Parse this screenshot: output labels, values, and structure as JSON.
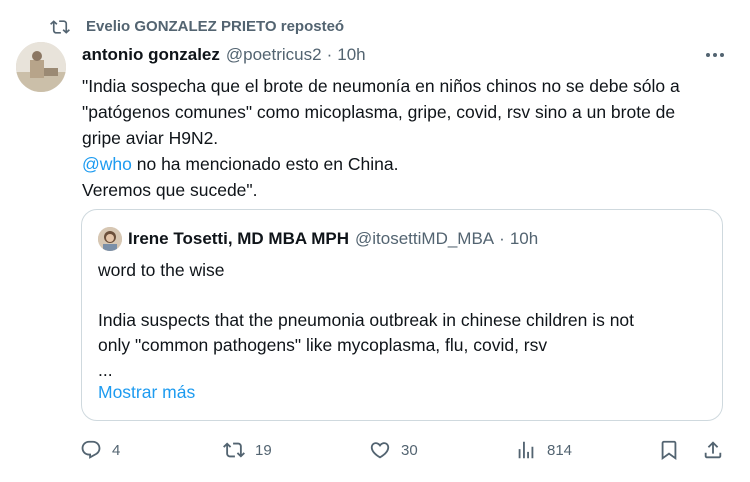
{
  "repost": {
    "icon": "repost-icon",
    "text": "Evelio GONZALEZ PRIETO reposteó"
  },
  "tweet": {
    "author_name": "antonio gonzalez",
    "handle": "@poetricus2",
    "separator": "·",
    "time": "10h",
    "body": {
      "line1": "\"India sospecha que el brote de neumonía en niños chinos no se debe sólo a",
      "line2": "\"patógenos comunes\" como micoplasma, gripe, covid, rsv sino a un brote de",
      "line3": "gripe aviar H9N2.",
      "mention": "@who",
      "line4_rest": " no ha mencionado esto en China.",
      "line5": "Veremos que sucede\"."
    }
  },
  "quote": {
    "author_name": "Irene Tosetti, MD MBA MPH",
    "handle": "@itosettiMD_MBA",
    "separator": "·",
    "time": "10h",
    "body": {
      "line1": "word to the wise",
      "line2": "",
      "line3": "India suspects that the pneumonia outbreak in chinese children is not",
      "line4": "only \"common pathogens\" like mycoplasma, flu, covid, rsv",
      "line5": "..."
    },
    "show_more": "Mostrar más"
  },
  "actions": {
    "reply": {
      "icon": "reply-icon",
      "count": "4"
    },
    "repost": {
      "icon": "repost-icon",
      "count": "19"
    },
    "like": {
      "icon": "heart-icon",
      "count": "30"
    },
    "views": {
      "icon": "views-icon",
      "count": "814"
    },
    "bookmark": {
      "icon": "bookmark-icon"
    },
    "share": {
      "icon": "share-icon"
    }
  },
  "colors": {
    "accent": "#1d9bf0",
    "secondary_text": "#536471",
    "border": "#cfd9de"
  }
}
